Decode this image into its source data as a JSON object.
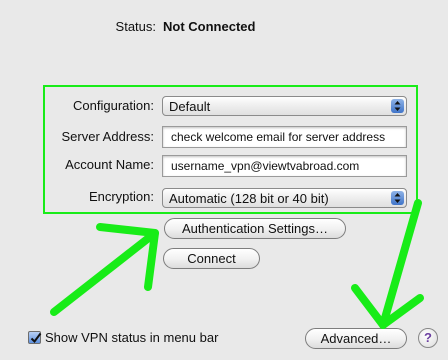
{
  "status": {
    "label": "Status:",
    "value": "Not Connected"
  },
  "configuration": {
    "label": "Configuration:",
    "value": "Default"
  },
  "server_address": {
    "label": "Server Address:",
    "value": "check welcome email for server address"
  },
  "account_name": {
    "label": "Account Name:",
    "value": "username_vpn@viewtvabroad.com"
  },
  "encryption": {
    "label": "Encryption:",
    "value": "Automatic (128 bit or 40 bit)"
  },
  "buttons": {
    "authentication": "Authentication Settings…",
    "connect": "Connect",
    "advanced": "Advanced…",
    "help": "?"
  },
  "show_status": {
    "label": "Show VPN status in menu bar",
    "checked": true
  },
  "colors": {
    "annotation": "#18ec18",
    "popup_arrow": "#3f74c9",
    "background": "#e9e9e9"
  }
}
